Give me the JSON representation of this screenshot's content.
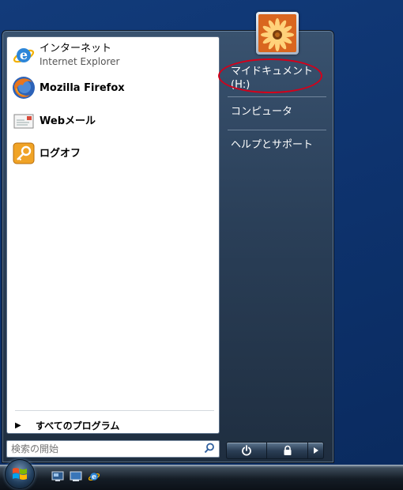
{
  "start_menu": {
    "pinned": [
      {
        "name": "インターネット",
        "subtitle": "Internet Explorer",
        "icon": "internet-explorer-icon"
      },
      {
        "name": "Mozilla Firefox",
        "icon": "firefox-icon"
      },
      {
        "name": "Webメール",
        "icon": "mail-icon"
      },
      {
        "name": "ログオフ",
        "icon": "logoff-key-icon"
      }
    ],
    "all_programs": "すべてのプログラム",
    "search_placeholder": "検索の開始",
    "right_items": [
      {
        "label_line1": "マイドキュメント",
        "label_line2": "(H:)",
        "highlighted": true,
        "highlight_color": "#d4001a"
      },
      {
        "label": "コンピュータ"
      },
      {
        "label": "ヘルプとサポート"
      }
    ],
    "user_picture": "orange-flower-icon"
  },
  "taskbar": {
    "start_orb": "windows-logo-icon",
    "quick_launch": [
      "show-desktop-icon",
      "switch-windows-icon",
      "internet-explorer-icon"
    ]
  }
}
